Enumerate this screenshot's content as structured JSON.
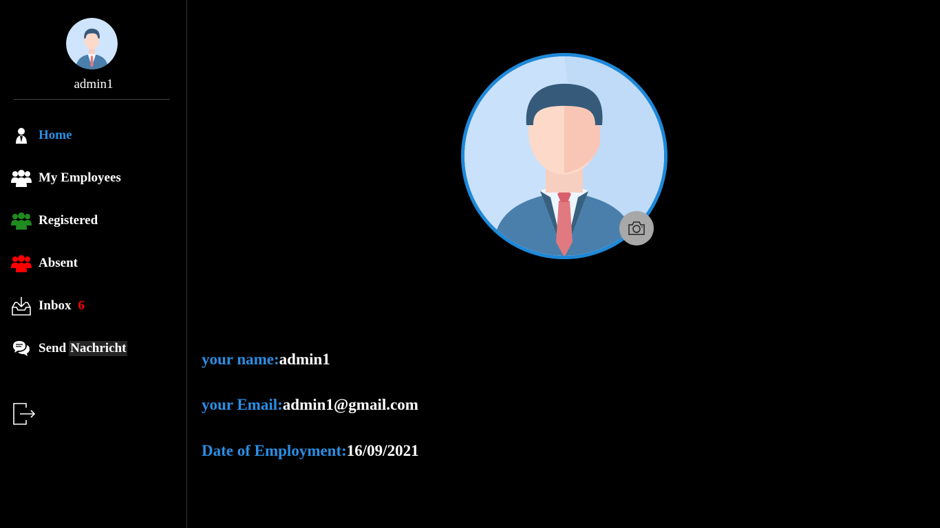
{
  "sidebar": {
    "username": "admin1",
    "nav": [
      {
        "label": "Home",
        "icon": "user-icon",
        "active": true
      },
      {
        "label": "My Employees",
        "icon": "group-icon"
      },
      {
        "label": "Registered",
        "icon": "group-green-icon"
      },
      {
        "label": "Absent",
        "icon": "group-red-icon"
      },
      {
        "label": "Inbox",
        "icon": "inbox-icon",
        "badge": "6"
      },
      {
        "label": "Send",
        "highlight": "Nachricht",
        "icon": "chat-icon"
      }
    ],
    "logout_icon": "logout-icon"
  },
  "profile": {
    "name_label": "your name:",
    "name": "admin1",
    "email_label": "your Email:",
    "email": "admin1@gmail.com",
    "date_label": "Date of Employment:",
    "date": "16/09/2021"
  },
  "colors": {
    "accent": "#2b8ee3",
    "registered": "#1f8a1f",
    "absent": "#ff0000",
    "badge": "#ff0000"
  }
}
